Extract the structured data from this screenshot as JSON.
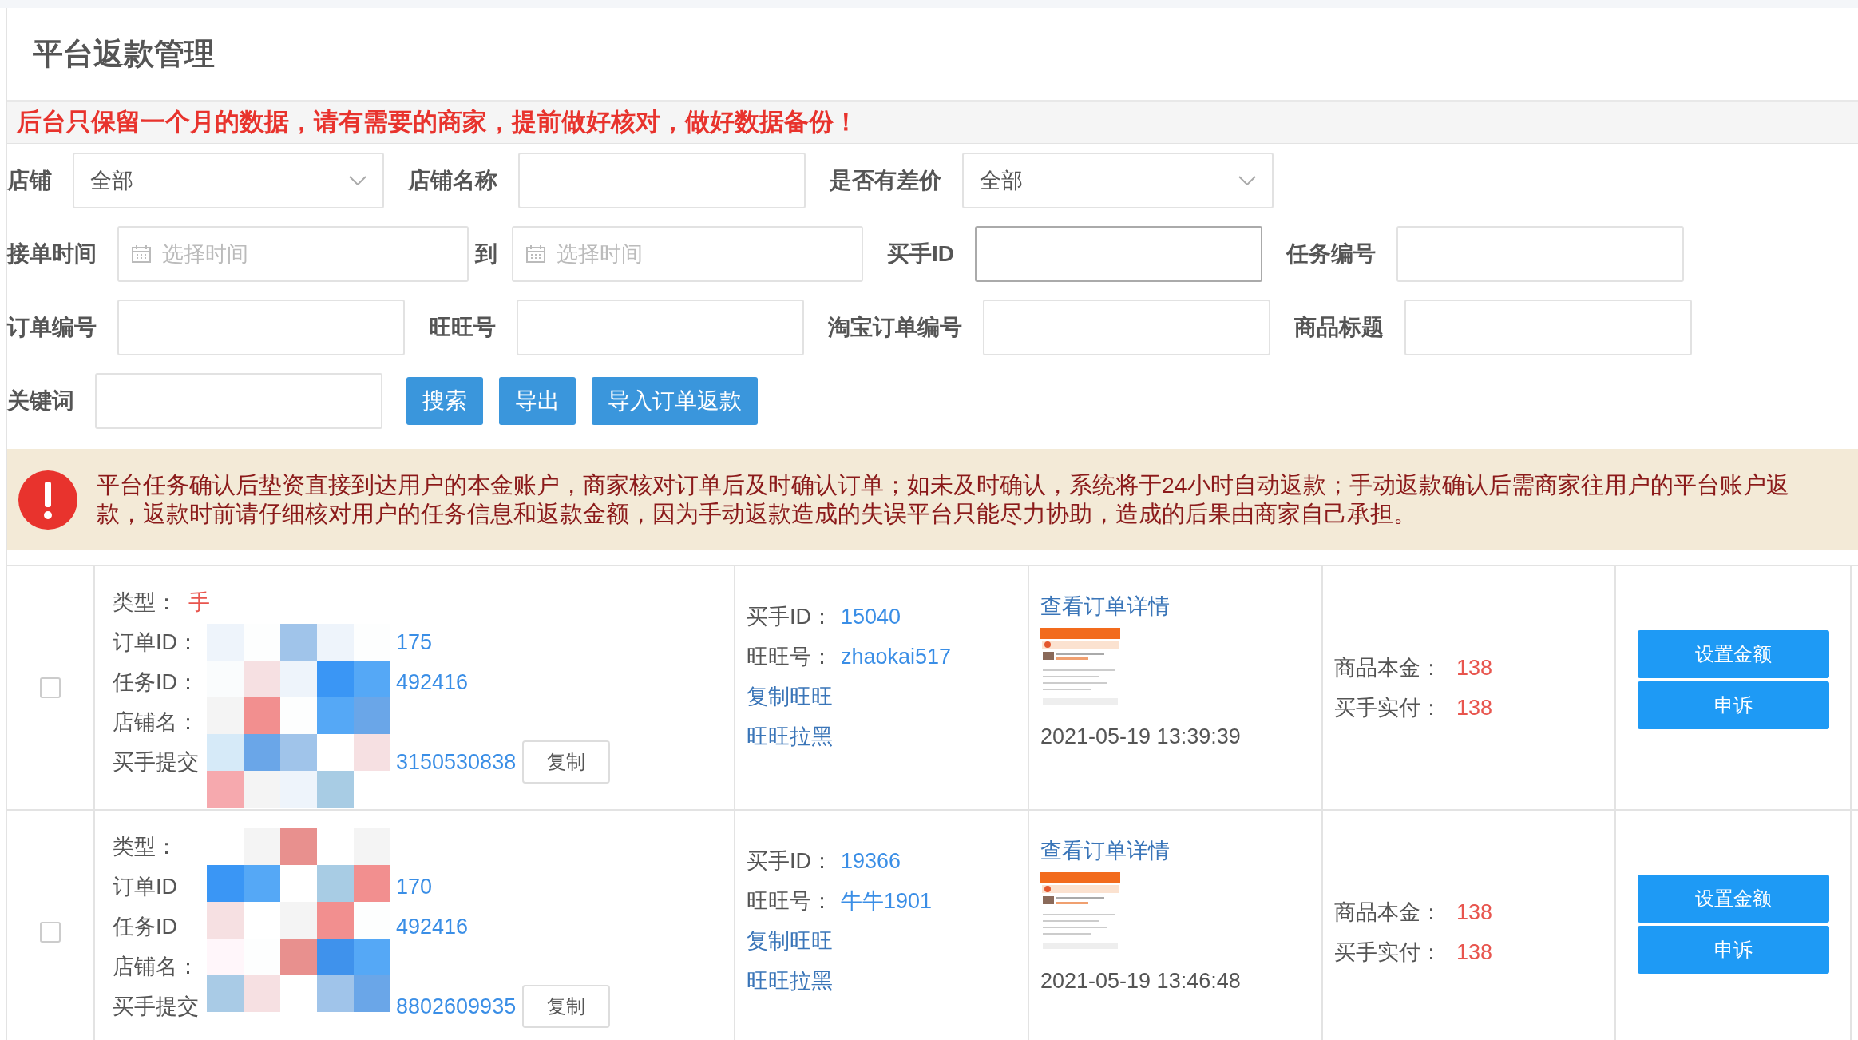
{
  "page_title": "平台返款管理",
  "notice": "后台只保留一个月的数据，请有需要的商家，提前做好核对，做好数据备份！",
  "filter_rows": [
    [
      {
        "kind": "select",
        "label": "店铺",
        "value": "全部"
      },
      {
        "kind": "text",
        "label": "店铺名称"
      },
      {
        "kind": "select",
        "label": "是否有差价",
        "value": "全部"
      }
    ],
    [
      {
        "kind": "date",
        "label": "接单时间",
        "placeholder": "选择时间"
      },
      {
        "kind": "date",
        "label": "到",
        "placeholder": "选择时间"
      },
      {
        "kind": "text",
        "label": "买手ID",
        "focused": true
      },
      {
        "kind": "text",
        "label": "任务编号"
      }
    ],
    [
      {
        "kind": "text",
        "label": "订单编号"
      },
      {
        "kind": "text",
        "label": "旺旺号"
      },
      {
        "kind": "text",
        "label": "淘宝订单编号"
      },
      {
        "kind": "text",
        "label": "商品标题"
      }
    ],
    [
      {
        "kind": "text",
        "label": "关键词"
      }
    ]
  ],
  "buttons": [
    "搜索",
    "导出",
    "导入订单返款"
  ],
  "warning": "平台任务确认后垫资直接到达用户的本金账户，商家核对订单后及时确认订单；如未及时确认，系统将于24小时自动返款；手动返款确认后需商家往用户的平台账户返款，返款时前请仔细核对用户的任务信息和返款金额，因为手动返款造成的失误平台只能尽力协助，造成的后果由商家自己承担。",
  "rows": [
    {
      "checked": false,
      "info": [
        {
          "label": "类型：",
          "value": "手",
          "kind": "type"
        },
        {
          "label": "订单ID：",
          "value": "175"
        },
        {
          "label": "任务ID：",
          "value": "492416"
        },
        {
          "label": "店铺名："
        },
        {
          "label": "买手提交",
          "value": "3150530838",
          "copy": "复制"
        }
      ],
      "buyer_id_label": "买手ID：",
      "buyer_id": "15040",
      "wangwang_label": "旺旺号：",
      "wangwang": "zhaokai517",
      "links": [
        "复制旺旺",
        "旺旺拉黑"
      ],
      "detail_link": "查看订单详情",
      "time": "2021-05-19 13:39:39",
      "amounts": [
        {
          "label": "商品本金：",
          "value": "138"
        },
        {
          "label": "买手实付：",
          "value": "138"
        }
      ],
      "actions": [
        "设置金额",
        "申诉"
      ]
    },
    {
      "checked": false,
      "info": [
        {
          "label": "类型："
        },
        {
          "label": "订单ID",
          "value": "170"
        },
        {
          "label": "任务ID",
          "value": "492416"
        },
        {
          "label": "店铺名："
        },
        {
          "label": "买手提交",
          "value": "8802609935",
          "copy": "复制"
        }
      ],
      "buyer_id_label": "买手ID：",
      "buyer_id": "19366",
      "wangwang_label": "旺旺号：",
      "wangwang": "牛牛1901",
      "links": [
        "复制旺旺",
        "旺旺拉黑"
      ],
      "detail_link": "查看订单详情",
      "time": "2021-05-19 13:46:48",
      "amounts": [
        {
          "label": "商品本金：",
          "value": "138"
        },
        {
          "label": "买手实付：",
          "value": "138"
        }
      ],
      "actions": [
        "设置金额",
        "申诉"
      ]
    }
  ]
}
